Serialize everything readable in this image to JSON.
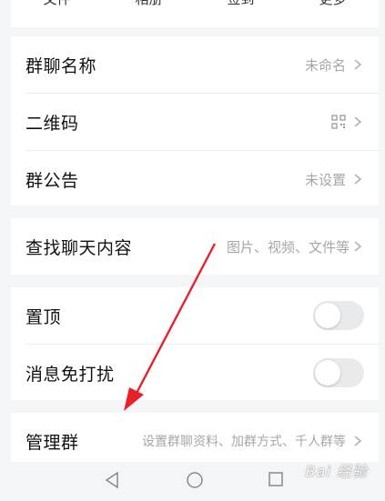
{
  "top_tabs": [
    "文件",
    "相册",
    "签到",
    "更多"
  ],
  "rows": {
    "group_name": {
      "label": "群聊名称",
      "value": "未命名"
    },
    "qr_code": {
      "label": "二维码"
    },
    "announcement": {
      "label": "群公告",
      "value": "未设置"
    },
    "search_history": {
      "label": "查找聊天内容",
      "value": "图片、视频、文件等"
    },
    "pin_top": {
      "label": "置顶",
      "enabled": false
    },
    "mute": {
      "label": "消息免打扰",
      "enabled": false
    },
    "manage_group": {
      "label": "管理群",
      "value": "设置群聊资料、加群方式、千人群等"
    }
  },
  "watermark": "Bai 经验",
  "colors": {
    "arrow": "#e8202a",
    "secondary_text": "#a6a6a6"
  }
}
